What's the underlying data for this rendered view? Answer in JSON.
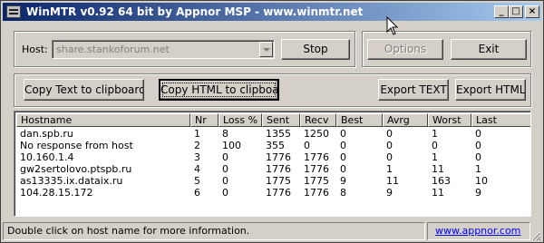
{
  "window": {
    "title": "WinMTR v0.92 64 bit by Appnor MSP - www.winmtr.net",
    "minimize_glyph": "_",
    "maximize_glyph": "□",
    "close_glyph": "×",
    "titlebar_colors": [
      "#0a246a",
      "#a6caf0"
    ]
  },
  "host_panel": {
    "host_label": "Host:",
    "host_value": "share.stankoforum.net",
    "stop_label": "Stop"
  },
  "options_panel": {
    "options_label": "Options",
    "exit_label": "Exit"
  },
  "export": {
    "copy_text_label": "Copy Text to clipboard",
    "copy_html_label": "Copy HTML to clipboard",
    "export_text_label": "Export TEXT",
    "export_html_label": "Export HTML"
  },
  "table": {
    "columns": [
      "Hostname",
      "Nr",
      "Loss %",
      "Sent",
      "Recv",
      "Best",
      "Avrg",
      "Worst",
      "Last"
    ],
    "rows": [
      [
        "dan.spb.ru",
        "1",
        "8",
        "1355",
        "1250",
        "0",
        "0",
        "1",
        "0"
      ],
      [
        "No response from host",
        "2",
        "100",
        "355",
        "0",
        "0",
        "0",
        "0",
        "0"
      ],
      [
        "10.160.1.4",
        "3",
        "0",
        "1776",
        "1776",
        "0",
        "0",
        "1",
        "0"
      ],
      [
        "gw2sertolovo.ptspb.ru",
        "4",
        "0",
        "1776",
        "1776",
        "0",
        "1",
        "11",
        "1"
      ],
      [
        "as13335.ix.dataix.ru",
        "5",
        "0",
        "1775",
        "1775",
        "9",
        "11",
        "163",
        "10"
      ],
      [
        "104.28.15.172",
        "6",
        "0",
        "1776",
        "1776",
        "8",
        "9",
        "11",
        "9"
      ]
    ]
  },
  "status": {
    "message": "Double click on host name for more information.",
    "link": "www.appnor.com",
    "link_color": "#0000ff"
  }
}
